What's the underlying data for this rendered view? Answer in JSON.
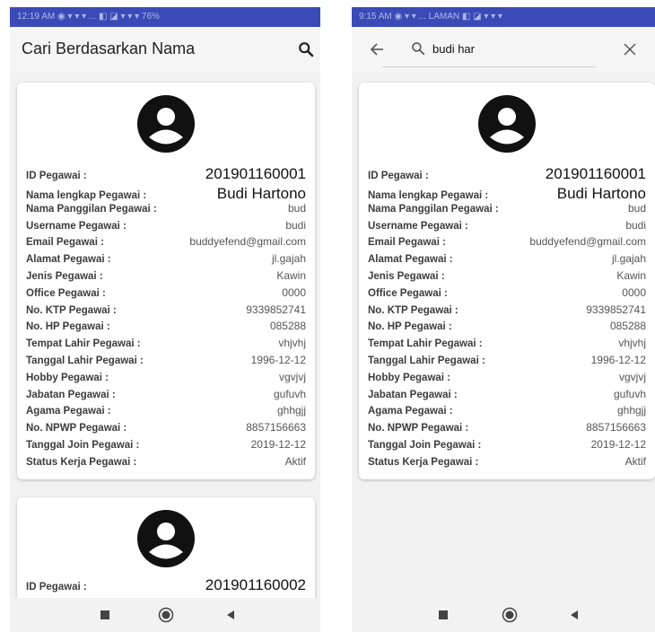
{
  "left_screen": {
    "status_text": "12:19 AM  ◉ ▾ ▾ ▾ ...  ◧ ◪ ▾ ▾ ▾ 76%",
    "title": "Cari Berdasarkan Nama",
    "cards": [
      {
        "id": "201901160001",
        "rows": [
          {
            "label": "Nama lengkap Pegawai :",
            "value": "Budi Hartono",
            "big": true
          },
          {
            "label": "Nama Panggilan Pegawai :",
            "value": "bud"
          },
          {
            "label": "Username Pegawai :",
            "value": "budi"
          },
          {
            "label": "Email Pegawai :",
            "value": "buddyefend@gmail.com"
          },
          {
            "label": "Alamat Pegawai :",
            "value": "jl.gajah"
          },
          {
            "label": "Jenis Pegawai :",
            "value": "Kawin"
          },
          {
            "label": "Office Pegawai :",
            "value": "0000"
          },
          {
            "label": "No. KTP Pegawai :",
            "value": "9339852741"
          },
          {
            "label": "No. HP Pegawai :",
            "value": "085288"
          },
          {
            "label": "Tempat Lahir Pegawai :",
            "value": "vhjvhj"
          },
          {
            "label": "Tanggal Lahir Pegawai :",
            "value": "1996-12-12"
          },
          {
            "label": "Hobby Pegawai :",
            "value": "vgvjvj"
          },
          {
            "label": "Jabatan Pegawai :",
            "value": "gufuvh"
          },
          {
            "label": "Agama Pegawai :",
            "value": "ghhgjj"
          },
          {
            "label": "No. NPWP Pegawai :",
            "value": "8857156663"
          },
          {
            "label": "Tanggal Join Pegawai :",
            "value": "2019-12-12"
          },
          {
            "label": "Status Kerja Pegawai :",
            "value": "Aktif"
          }
        ]
      },
      {
        "id": "201901160002"
      }
    ],
    "id_label": "ID Pegawai :"
  },
  "right_screen": {
    "status_text": "9:15 AM  ◉ ▾ ▾ ...  LAMAN  ◧ ◪ ▾ ▾ ▾",
    "search_value": "budi har",
    "id_label": "ID Pegawai :",
    "card": {
      "id": "201901160001",
      "rows": [
        {
          "label": "Nama lengkap Pegawai :",
          "value": "Budi Hartono",
          "big": true
        },
        {
          "label": "Nama Panggilan Pegawai :",
          "value": "bud"
        },
        {
          "label": "Username Pegawai :",
          "value": "budi"
        },
        {
          "label": "Email Pegawai :",
          "value": "buddyefend@gmail.com"
        },
        {
          "label": "Alamat Pegawai :",
          "value": "jl.gajah"
        },
        {
          "label": "Jenis Pegawai :",
          "value": "Kawin"
        },
        {
          "label": "Office Pegawai :",
          "value": "0000"
        },
        {
          "label": "No. KTP Pegawai :",
          "value": "9339852741"
        },
        {
          "label": "No. HP Pegawai :",
          "value": "085288"
        },
        {
          "label": "Tempat Lahir Pegawai :",
          "value": "vhjvhj"
        },
        {
          "label": "Tanggal Lahir Pegawai :",
          "value": "1996-12-12"
        },
        {
          "label": "Hobby Pegawai :",
          "value": "vgvjvj"
        },
        {
          "label": "Jabatan Pegawai :",
          "value": "gufuvh"
        },
        {
          "label": "Agama Pegawai :",
          "value": "ghhgjj"
        },
        {
          "label": "No. NPWP Pegawai :",
          "value": "8857156663"
        },
        {
          "label": "Tanggal Join Pegawai :",
          "value": "2019-12-12"
        },
        {
          "label": "Status Kerja Pegawai :",
          "value": "Aktif"
        }
      ]
    }
  },
  "colors": {
    "status_bar": "#3a4bb8",
    "card_bg": "#ffffff",
    "screen_bg": "#f2f2f2"
  },
  "icons": [
    "search-icon",
    "back-arrow-icon",
    "close-icon",
    "avatar-icon",
    "nav-square-icon",
    "nav-home-icon",
    "nav-back-icon"
  ]
}
